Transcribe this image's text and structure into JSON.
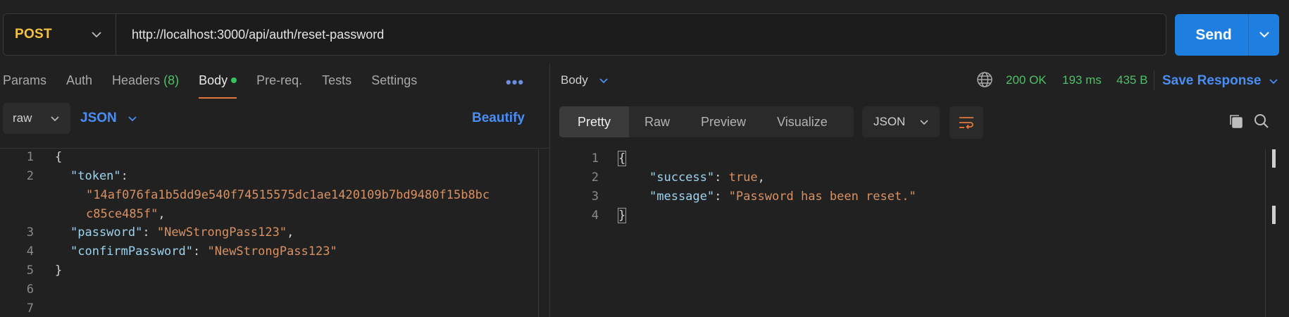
{
  "request": {
    "method": "POST",
    "url": "http://localhost:3000/api/auth/reset-password",
    "send_label": "Send"
  },
  "tabs": [
    {
      "label": "Params"
    },
    {
      "label": "Auth"
    },
    {
      "label": "Headers",
      "count": "(8)"
    },
    {
      "label": "Body"
    },
    {
      "label": "Pre-req."
    },
    {
      "label": "Tests"
    },
    {
      "label": "Settings"
    }
  ],
  "more_label": "•••",
  "body_controls": {
    "mode": "raw",
    "language": "JSON",
    "beautify_label": "Beautify"
  },
  "request_body": {
    "line_numbers": [
      "1",
      "2",
      "3",
      "4",
      "5",
      "6",
      "7"
    ],
    "lines": [
      {
        "open": "{"
      },
      {
        "key": "\"token\"",
        "sep": ":"
      },
      {
        "str": "\"14af076fa1b5dd9e540f74515575dc1ae1420109b7bd9480f15b8bc"
      },
      {
        "str": "c85ce485f\"",
        "tail": ","
      },
      {
        "key": "\"password\"",
        "sep": ": ",
        "str": "\"NewStrongPass123\"",
        "tail": ","
      },
      {
        "key": "\"confirmPassword\"",
        "sep": ": ",
        "str": "\"NewStrongPass123\""
      },
      {
        "close": "}"
      }
    ]
  },
  "response": {
    "section_label": "Body",
    "status": "200 OK",
    "time": "193 ms",
    "size": "435 B",
    "save_label": "Save Response",
    "views": [
      "Pretty",
      "Raw",
      "Preview",
      "Visualize"
    ],
    "format": "JSON",
    "line_numbers": [
      "1",
      "2",
      "3",
      "4"
    ],
    "open": "{",
    "close": "}",
    "success_key": "\"success\"",
    "success_val": "true",
    "message_key": "\"message\"",
    "message_val": "\"Password has been reset.\""
  },
  "colors": {
    "accent": "#1f7fe0",
    "method": "#f5c242",
    "status_ok": "#4fbf6a",
    "tab_underline": "#e2773d"
  }
}
